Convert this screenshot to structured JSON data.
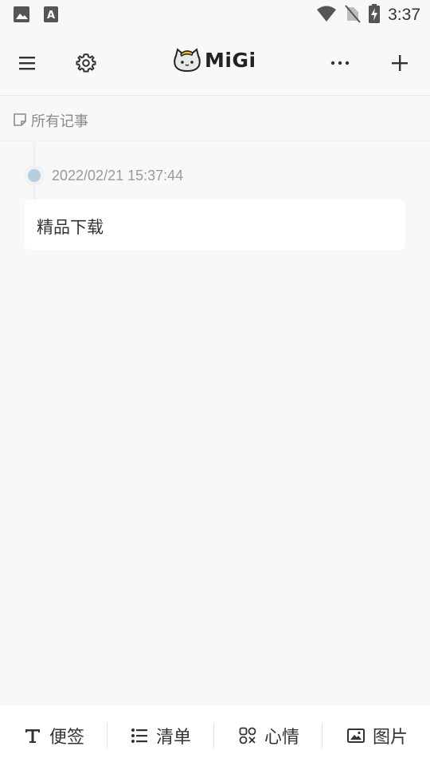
{
  "status_bar": {
    "time": "3:37",
    "left_icons": [
      "gallery-icon",
      "font-icon"
    ],
    "right_icons": [
      "wifi-icon",
      "no-sim-icon",
      "battery-charging-icon"
    ]
  },
  "header": {
    "logo_text": "MiGi",
    "buttons": [
      "menu-icon",
      "settings-icon",
      "more-icon",
      "add-icon"
    ]
  },
  "breadcrumb": {
    "label": "所有记事"
  },
  "notes": [
    {
      "date": "2022/02/21 15:37:44",
      "text": "精品下载"
    }
  ],
  "bottom_tabs": [
    {
      "label": "便签",
      "icon": "text-icon"
    },
    {
      "label": "清单",
      "icon": "list-icon"
    },
    {
      "label": "心情",
      "icon": "mood-icon"
    },
    {
      "label": "图片",
      "icon": "image-icon"
    }
  ],
  "colors": {
    "background": "#f8f8f8",
    "card": "#ffffff",
    "timeline_dot": "#b5cde0",
    "text_primary": "#333333",
    "text_secondary": "#9a9a9a"
  }
}
